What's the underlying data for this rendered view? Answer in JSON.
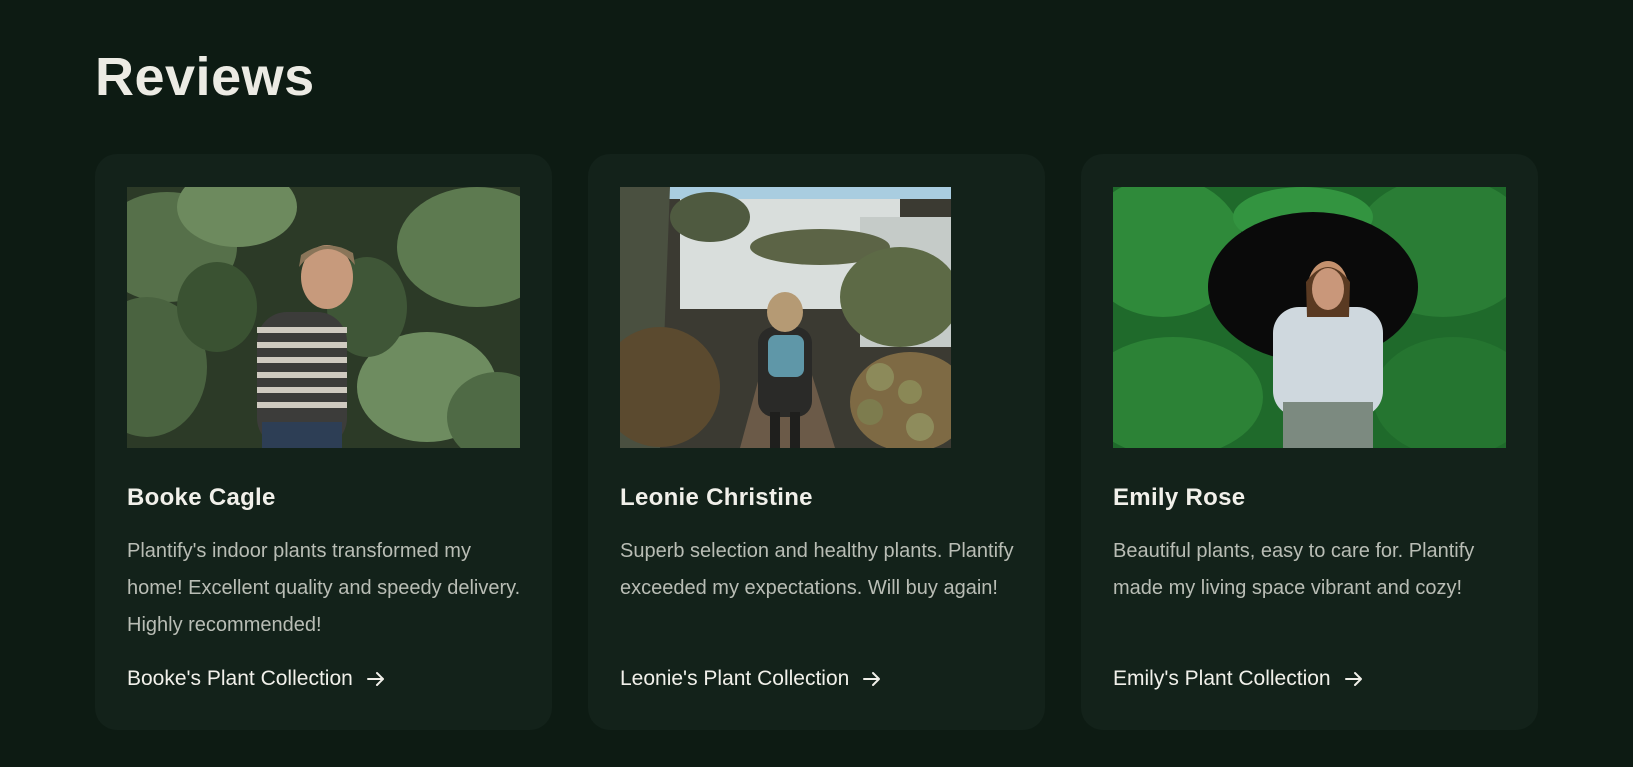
{
  "page": {
    "title": "Reviews"
  },
  "reviews": [
    {
      "name": "Booke Cagle",
      "text": "Plantify's indoor plants transformed my home! Excellent quality and speedy delivery. Highly recommended!",
      "link_label": "Booke's Plant Collection",
      "photo_icon": "woman-among-large-leaves-photo"
    },
    {
      "name": "Leonie Christine",
      "text": "Superb selection and healthy plants. Plantify exceeded my expectations. Will buy again!",
      "link_label": "Leonie's Plant Collection",
      "photo_icon": "greenhouse-cactus-aisle-photo"
    },
    {
      "name": "Emily Rose",
      "text": "Beautiful plants, easy to care for. Plantify made my living space vibrant and cozy!",
      "link_label": "Emily's Plant Collection",
      "photo_icon": "woman-with-umbrella-ivy-photo"
    }
  ],
  "colors": {
    "background": "#0d1b13",
    "card": "#13221a",
    "heading": "#ecebe4",
    "body_text": "#b9bdb5"
  },
  "icons": {
    "link_arrow": "arrow-right-icon"
  }
}
